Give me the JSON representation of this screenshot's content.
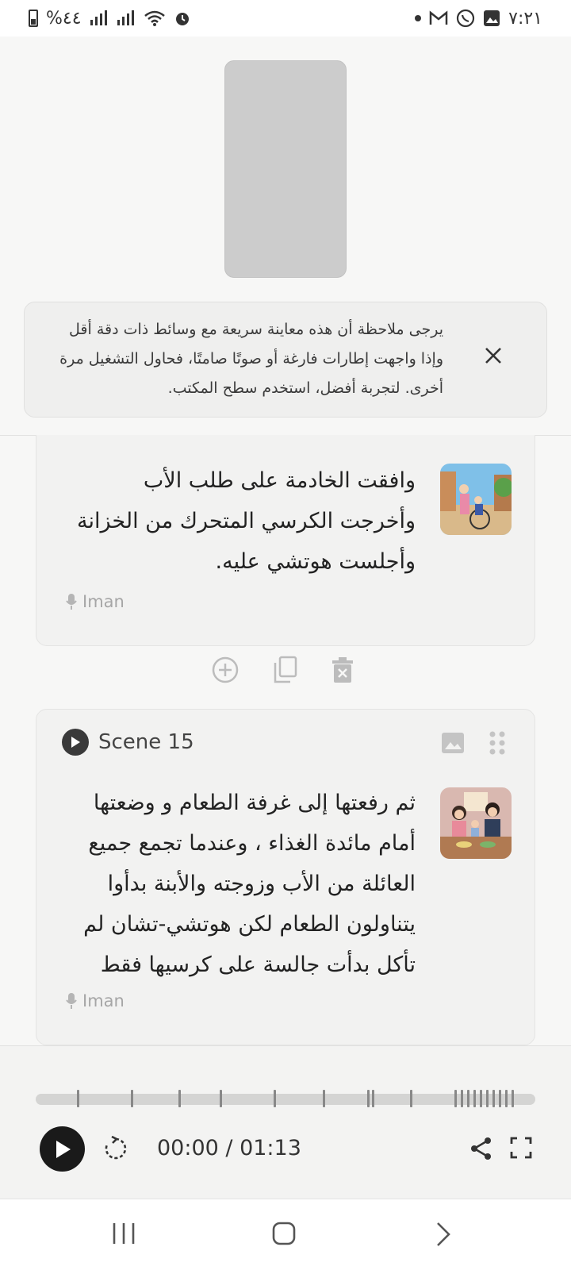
{
  "status_bar": {
    "battery": "%٤٤",
    "time": "٧:٢١",
    "icons": [
      "battery-icon",
      "signal-icon",
      "signal-icon",
      "wifi-icon",
      "alarm-icon",
      "dot-icon",
      "gmail-icon",
      "whatsapp-icon",
      "gallery-icon"
    ]
  },
  "notice": {
    "text": "يرجى ملاحظة أن هذه معاينة سريعة مع وسائط ذات دقة أقل وإذا واجهت إطارات فارغة أو صوتًا صامتًا، فحاول التشغيل مرة أخرى. لتجربة أفضل، استخدم سطح المكتب."
  },
  "scenes": [
    {
      "text": "وافقت الخادمة على طلب الأب وأخرجت الكرسي المتحرك من الخزانة وأجلست هوتشي عليه.",
      "voice": "Iman"
    },
    {
      "title": "Scene 15",
      "text": "ثم رفعتها إلى غرفة الطعام و وضعتها أمام مائدة الغذاء ، وعندما تجمع جميع العائلة من الأب وزوجته والأبنة بدأوا يتناولون الطعام لكن هوتشي-تشان لم تأكل بدأت جالسة على كرسيها فقط",
      "voice": "Iman"
    }
  ],
  "player": {
    "time": "00:00 / 01:13",
    "progress": 0
  },
  "colors": {
    "accent": "#1a1a1a",
    "card_bg": "#f2f2f1",
    "muted": "#a6a6a6"
  }
}
